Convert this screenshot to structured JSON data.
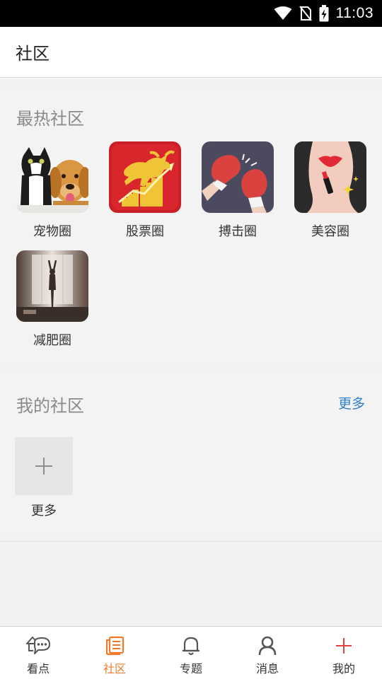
{
  "status_bar": {
    "time": "11:03"
  },
  "header": {
    "title": "社区"
  },
  "hot": {
    "title": "最热社区",
    "items": [
      {
        "label": "宠物圈",
        "icon": "pets-photo"
      },
      {
        "label": "股票圈",
        "icon": "bull-stock-chart"
      },
      {
        "label": "搏击圈",
        "icon": "boxing-glove"
      },
      {
        "label": "美容圈",
        "icon": "lipstick"
      },
      {
        "label": "减肥圈",
        "icon": "silhouette-window-photo"
      }
    ]
  },
  "mine": {
    "title": "我的社区",
    "more_link": "更多",
    "add_label": "更多"
  },
  "nav": {
    "items": [
      {
        "label": "看点",
        "icon": "chat-bubble-icon"
      },
      {
        "label": "社区",
        "icon": "document-icon",
        "active": true
      },
      {
        "label": "专题",
        "icon": "bell-icon"
      },
      {
        "label": "消息",
        "icon": "person-icon"
      },
      {
        "label": "我的",
        "icon": "plus-icon"
      }
    ]
  },
  "colors": {
    "accent": "#f07a2a",
    "link": "#2f7fd0",
    "plus_red": "#e64242"
  }
}
